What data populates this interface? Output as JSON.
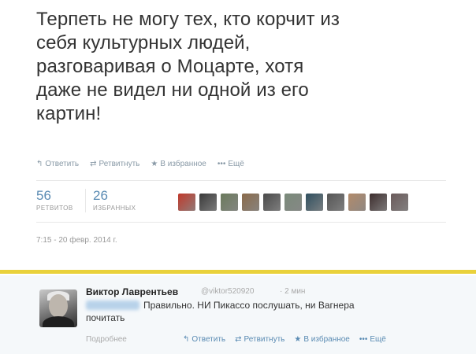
{
  "tweet": {
    "text": "Терпеть не могу тех, кто корчит из\nсебя культурных людей,\nразговаривая о Моцарте, хотя\nдаже не видел ни одной из его\nкартин!",
    "actions": [
      {
        "icon": "reply-icon",
        "glyph": "↰",
        "label": "Ответить"
      },
      {
        "icon": "retweet-icon",
        "glyph": "⇄",
        "label": "Ретвитнуть"
      },
      {
        "icon": "star-icon",
        "glyph": "★",
        "label": "В избранное"
      },
      {
        "icon": "more-icon",
        "glyph": "•••",
        "label": "Ещё"
      }
    ],
    "stats": {
      "retweets": {
        "value": "56",
        "label": "РЕТВИТОВ"
      },
      "favorites": {
        "value": "26",
        "label": "ИЗБРАННЫХ"
      }
    },
    "avatar_colors": [
      "#c0392b",
      "#3a3a3a",
      "#6b7a5c",
      "#8a6a4a",
      "#4a4a4a",
      "#7a8a7a",
      "#2f4f5f",
      "#555555",
      "#b28a6a",
      "#3d2d2d",
      "#6a5a5a"
    ],
    "timestamp": "7:15 - 20 февр. 2014 г."
  },
  "colors": {
    "accent": "#5a8bb3",
    "highlight_bar": "#e9d13b"
  },
  "reply": {
    "name": "Виктор Лаврентьев",
    "handle": "@viktor520920",
    "time": "· 2 мин",
    "text_line1": "Правильно. НИ Пикассо послушать, ни Вагнера",
    "text_line2": "почитать",
    "more": "Подробнее",
    "actions": [
      {
        "icon": "reply-icon",
        "glyph": "↰",
        "label": "Ответить"
      },
      {
        "icon": "retweet-icon",
        "glyph": "⇄",
        "label": "Ретвитнуть"
      },
      {
        "icon": "star-icon",
        "glyph": "★",
        "label": "В избранное"
      },
      {
        "icon": "more-icon",
        "glyph": "•••",
        "label": "Ещё"
      }
    ]
  }
}
